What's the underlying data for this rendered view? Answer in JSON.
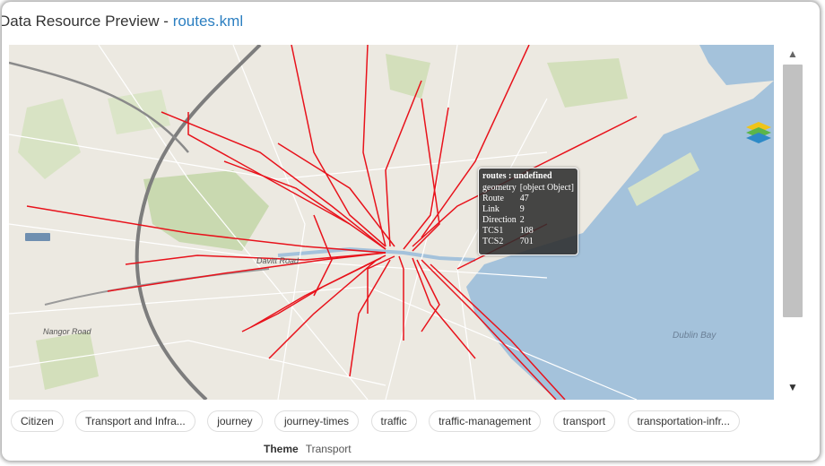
{
  "header": {
    "prefix": "Data Resource Preview - ",
    "file": "routes.kml"
  },
  "map": {
    "popup": {
      "title": "routes : undefined",
      "rows": [
        {
          "k": "geometry",
          "v": "[object Object]"
        },
        {
          "k": "Route",
          "v": "47"
        },
        {
          "k": "Link",
          "v": "9"
        },
        {
          "k": "Direction",
          "v": "2"
        },
        {
          "k": "TCS1",
          "v": "108"
        },
        {
          "k": "TCS2",
          "v": "701"
        }
      ]
    },
    "labels": {
      "bay": "Dublin Bay",
      "road1": "Davitt Road",
      "road2": "Nangor Road"
    },
    "colors": {
      "water": "#a4c2db",
      "land": "#ece9e1",
      "park": "#c9d9b0",
      "route": "#e8121b",
      "motorway": "#7d7d7d"
    },
    "layer_icon": "layers-icon"
  },
  "scrollbar": {
    "up": "▲",
    "down": "▼"
  },
  "tags": [
    "Citizen",
    "Transport and Infra...",
    "journey",
    "journey-times",
    "traffic",
    "traffic-management",
    "transport",
    "transportation-infr..."
  ],
  "meta": {
    "key": "Theme",
    "value": "Transport"
  }
}
